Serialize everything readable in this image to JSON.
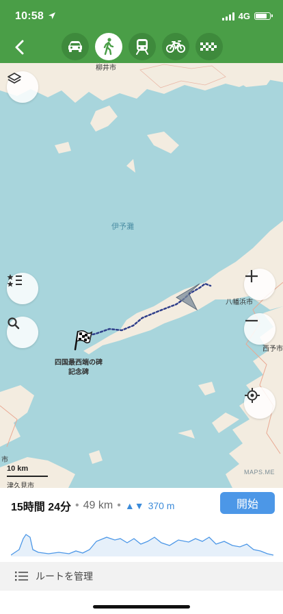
{
  "status_bar": {
    "time": "10:58",
    "network": "4G",
    "battery_level": 0.85
  },
  "colors": {
    "header_green": "#4a9e47",
    "start_blue": "#4c97e7",
    "water": "#a8d5dc",
    "land": "#f3ece0",
    "route": "#2e3e8a"
  },
  "nav": {
    "back_icon": "chevron-left-icon",
    "modes": [
      {
        "name": "car",
        "icon": "car-icon",
        "active": false
      },
      {
        "name": "walk",
        "icon": "walk-icon",
        "active": true
      },
      {
        "name": "train",
        "icon": "train-icon",
        "active": false
      },
      {
        "name": "bicycle",
        "icon": "bicycle-icon",
        "active": false
      },
      {
        "name": "taxi",
        "icon": "taxi-icon",
        "active": false
      }
    ]
  },
  "map": {
    "labels": {
      "top_city": "柳井市",
      "sea": "伊予灘",
      "yawatahama": "八幡浜市",
      "seiyo": "西予市",
      "left_city": "市",
      "tsukumi": "津久見市",
      "landmark_line1": "四国最西端の碑",
      "landmark_line2": "記念碑"
    },
    "scale": "10 km",
    "attribution": "MAPS.ME",
    "controls": {
      "layers": "layers-icon",
      "bookmarks": "bookmarks-list-icon",
      "search": "search-icon",
      "zoom_in": "plus-icon",
      "zoom_out": "minus-icon",
      "locate": "locate-icon"
    }
  },
  "route": {
    "duration": "15時間 24分",
    "distance": "49 km",
    "elevation": "370 m",
    "start_button": "開始",
    "manage_label": "ルートを管理"
  }
}
